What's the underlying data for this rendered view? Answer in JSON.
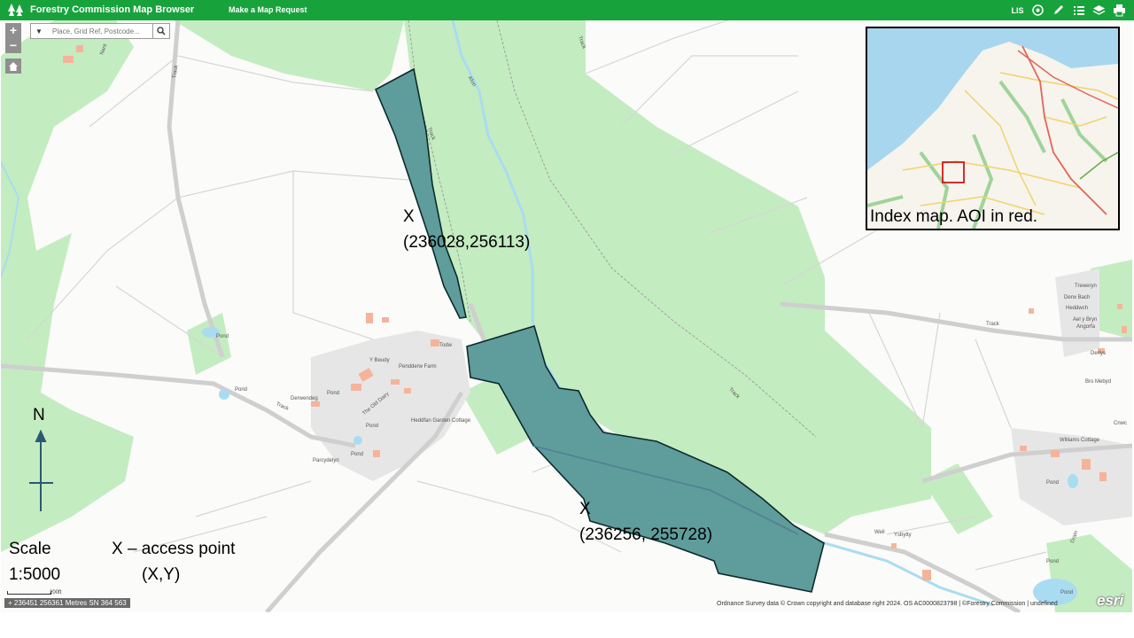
{
  "header": {
    "title": "Forestry Commission Map Browser",
    "request_link": "Make a Map Request",
    "lis_label": "LIS"
  },
  "search": {
    "placeholder": "Place, Grid Ref, Postcode..."
  },
  "zoom": {
    "in_label": "+",
    "out_label": "−"
  },
  "annotations": {
    "access_point_1_mark": "X",
    "access_point_1_coords": "(236028,256113)",
    "access_point_2_mark": "X",
    "access_point_2_coords": "(236256, 255728)",
    "north_label": "N",
    "scale_label": "Scale",
    "scale_value": "1:5000",
    "legend_title": "X – access point",
    "legend_xy": "(X,Y)"
  },
  "index_map": {
    "caption": "Index map. AOI in red."
  },
  "place_labels": {
    "trewerym": "Treweryn",
    "derw_bach": "Derw Bach",
    "heddwch": "Heddwch",
    "ael_y_bryn": "Ael y Bryn",
    "angorfa": "Angorfa",
    "derlys": "Derlys",
    "bro_mebyd": "Bro Mebyd",
    "cnwc": "Cnwc",
    "williams_cottage": "Williams Cottage",
    "pond_east": "Pond",
    "pond_se": "Pond",
    "pond_se2": "Pond",
    "well": "Well",
    "ysbytty": "Ysbytty",
    "pond_nw": "Pond",
    "pond_mid": "Pond",
    "pond_mid2": "Pond",
    "pond_village": "Pond",
    "derwendeg": "Derwendeg",
    "pond_v2": "Pond",
    "parcydelyn": "Parcydelyn",
    "y_beudy": "Y Beudy",
    "pendderw_farm": "Pendderw Farm",
    "todw": "Todw",
    "the_old_dairy": "The Old Dairy",
    "heddfan_garden_cottage": "Heddfan Garden Cottage",
    "track_1": "Track",
    "track_2": "Track",
    "track_3": "Track",
    "track_4": "Track",
    "track_5": "Track",
    "track_6": "Track",
    "afon": "Afon",
    "nant": "Nant",
    "drain": "Drain"
  },
  "footer": {
    "coordinates": "+ 236451 256361 Metres SN 364 563",
    "scalebar_label": "200ft",
    "attribution": "Ordnance Survey data © Crown copyright and database right 2024. OS AC0000823798 | ©Forestry Commission | undefined",
    "esri": "esri"
  },
  "colors": {
    "header_green": "#18a23c",
    "woodland_green": "#c4ecc1",
    "aoi_fill": "#5f9c9c",
    "aoi_stroke": "#0d2a2a",
    "index_aoi_red": "#d0181a",
    "north_arrow": "#2a5a72"
  },
  "icons": [
    "forestry-logo-icon",
    "search-icon",
    "dropdown-chevron-icon",
    "home-icon",
    "layers-icon",
    "pencil-icon",
    "list-icon",
    "print-icon",
    "basemap-icon"
  ]
}
